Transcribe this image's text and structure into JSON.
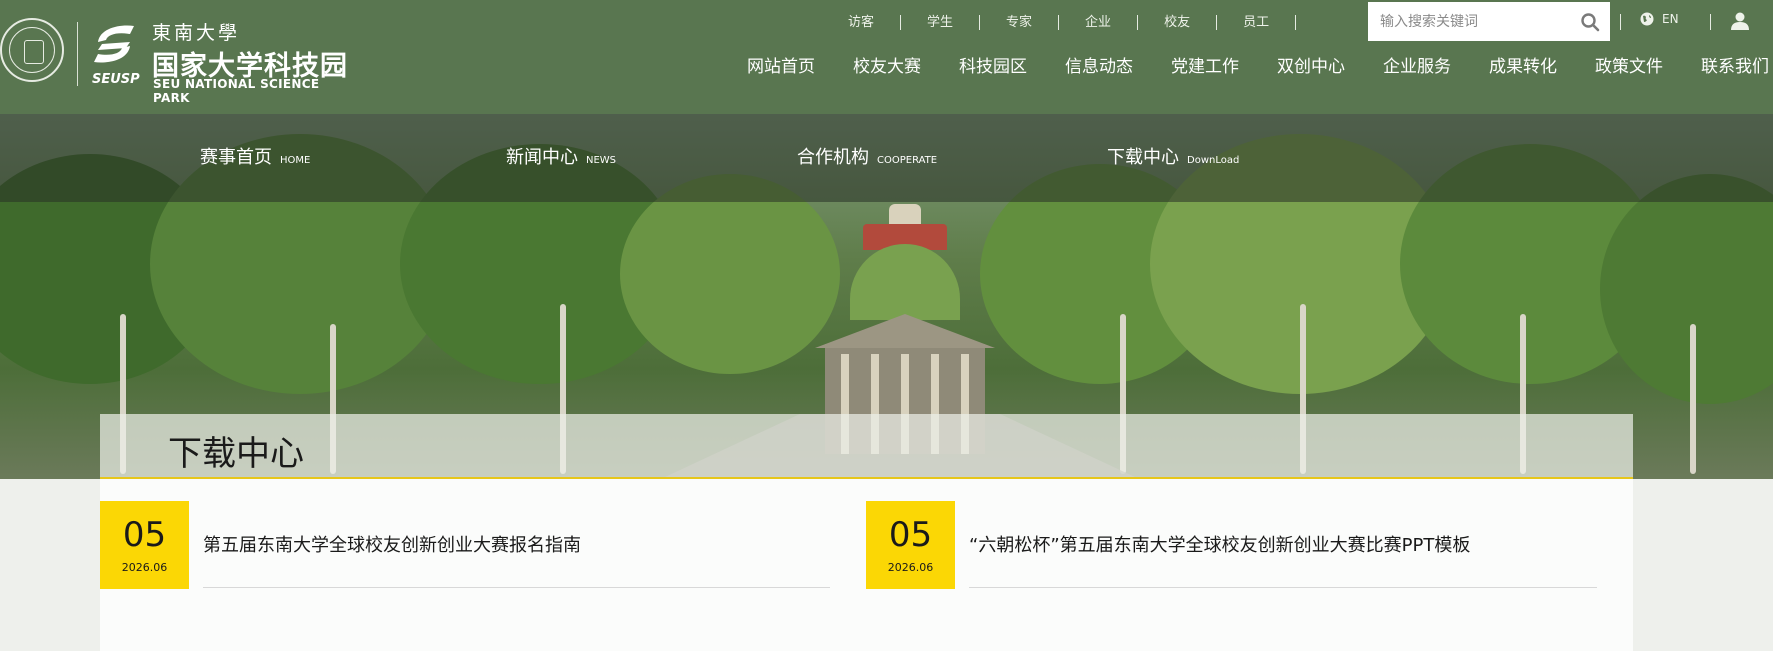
{
  "brand": {
    "school_name": "東南大學",
    "park_name": "国家大学科技园",
    "park_name_en": "SEU NATIONAL SCIENCE PARK",
    "short_name": "SEUSP"
  },
  "utility_links": [
    "访客",
    "学生",
    "专家",
    "企业",
    "校友",
    "员工"
  ],
  "search": {
    "placeholder": "输入搜索关键词",
    "icon": "search-icon"
  },
  "language": {
    "label": "EN",
    "icon": "globe-icon"
  },
  "account": {
    "icon": "user-icon"
  },
  "main_nav": [
    "网站首页",
    "校友大赛",
    "科技园区",
    "信息动态",
    "党建工作",
    "双创中心",
    "企业服务",
    "成果转化",
    "政策文件",
    "联系我们"
  ],
  "sub_nav": [
    {
      "label": "赛事首页",
      "en": "HOME"
    },
    {
      "label": "新闻中心",
      "en": "NEWS"
    },
    {
      "label": "合作机构",
      "en": "COOPERATE"
    },
    {
      "label": "下载中心",
      "en": "DownLoad"
    }
  ],
  "page_title": "下载中心",
  "articles": [
    {
      "day": "05",
      "year_month": "2026.06",
      "title": "第五届东南大学全球校友创新创业大赛报名指南"
    },
    {
      "day": "05",
      "year_month": "2026.06",
      "title": "“六朝松杯”第五届东南大学全球校友创新创业大赛比赛PPT模板"
    }
  ],
  "colors": {
    "header_bg": "#597650",
    "accent_yellow": "#fbd705",
    "title_underline": "#e6c61a"
  }
}
